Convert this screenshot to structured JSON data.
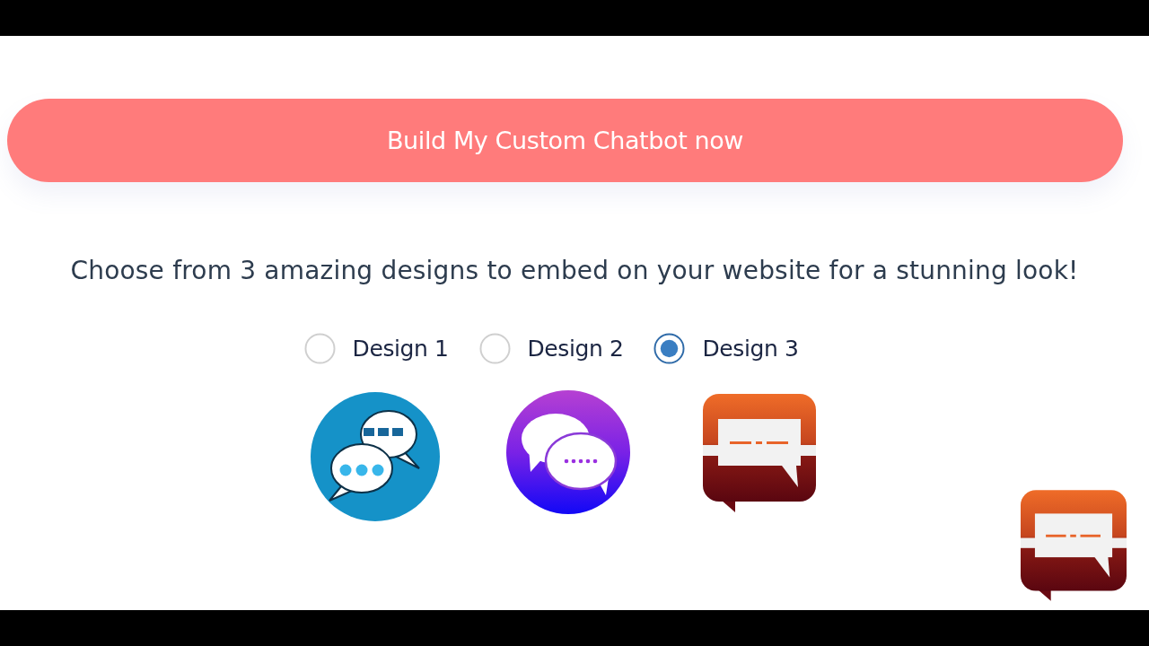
{
  "cta_button": {
    "label": "Build My Custom Chatbot now"
  },
  "intro_text": "Choose from 3 amazing designs to embed on your website for a stunning look!",
  "designs": [
    {
      "label": "Design 1",
      "selected": false,
      "kind": "classic"
    },
    {
      "label": "Design 2",
      "selected": false,
      "kind": "glossy"
    },
    {
      "label": "Design 3",
      "selected": true,
      "kind": "ribbon"
    }
  ]
}
